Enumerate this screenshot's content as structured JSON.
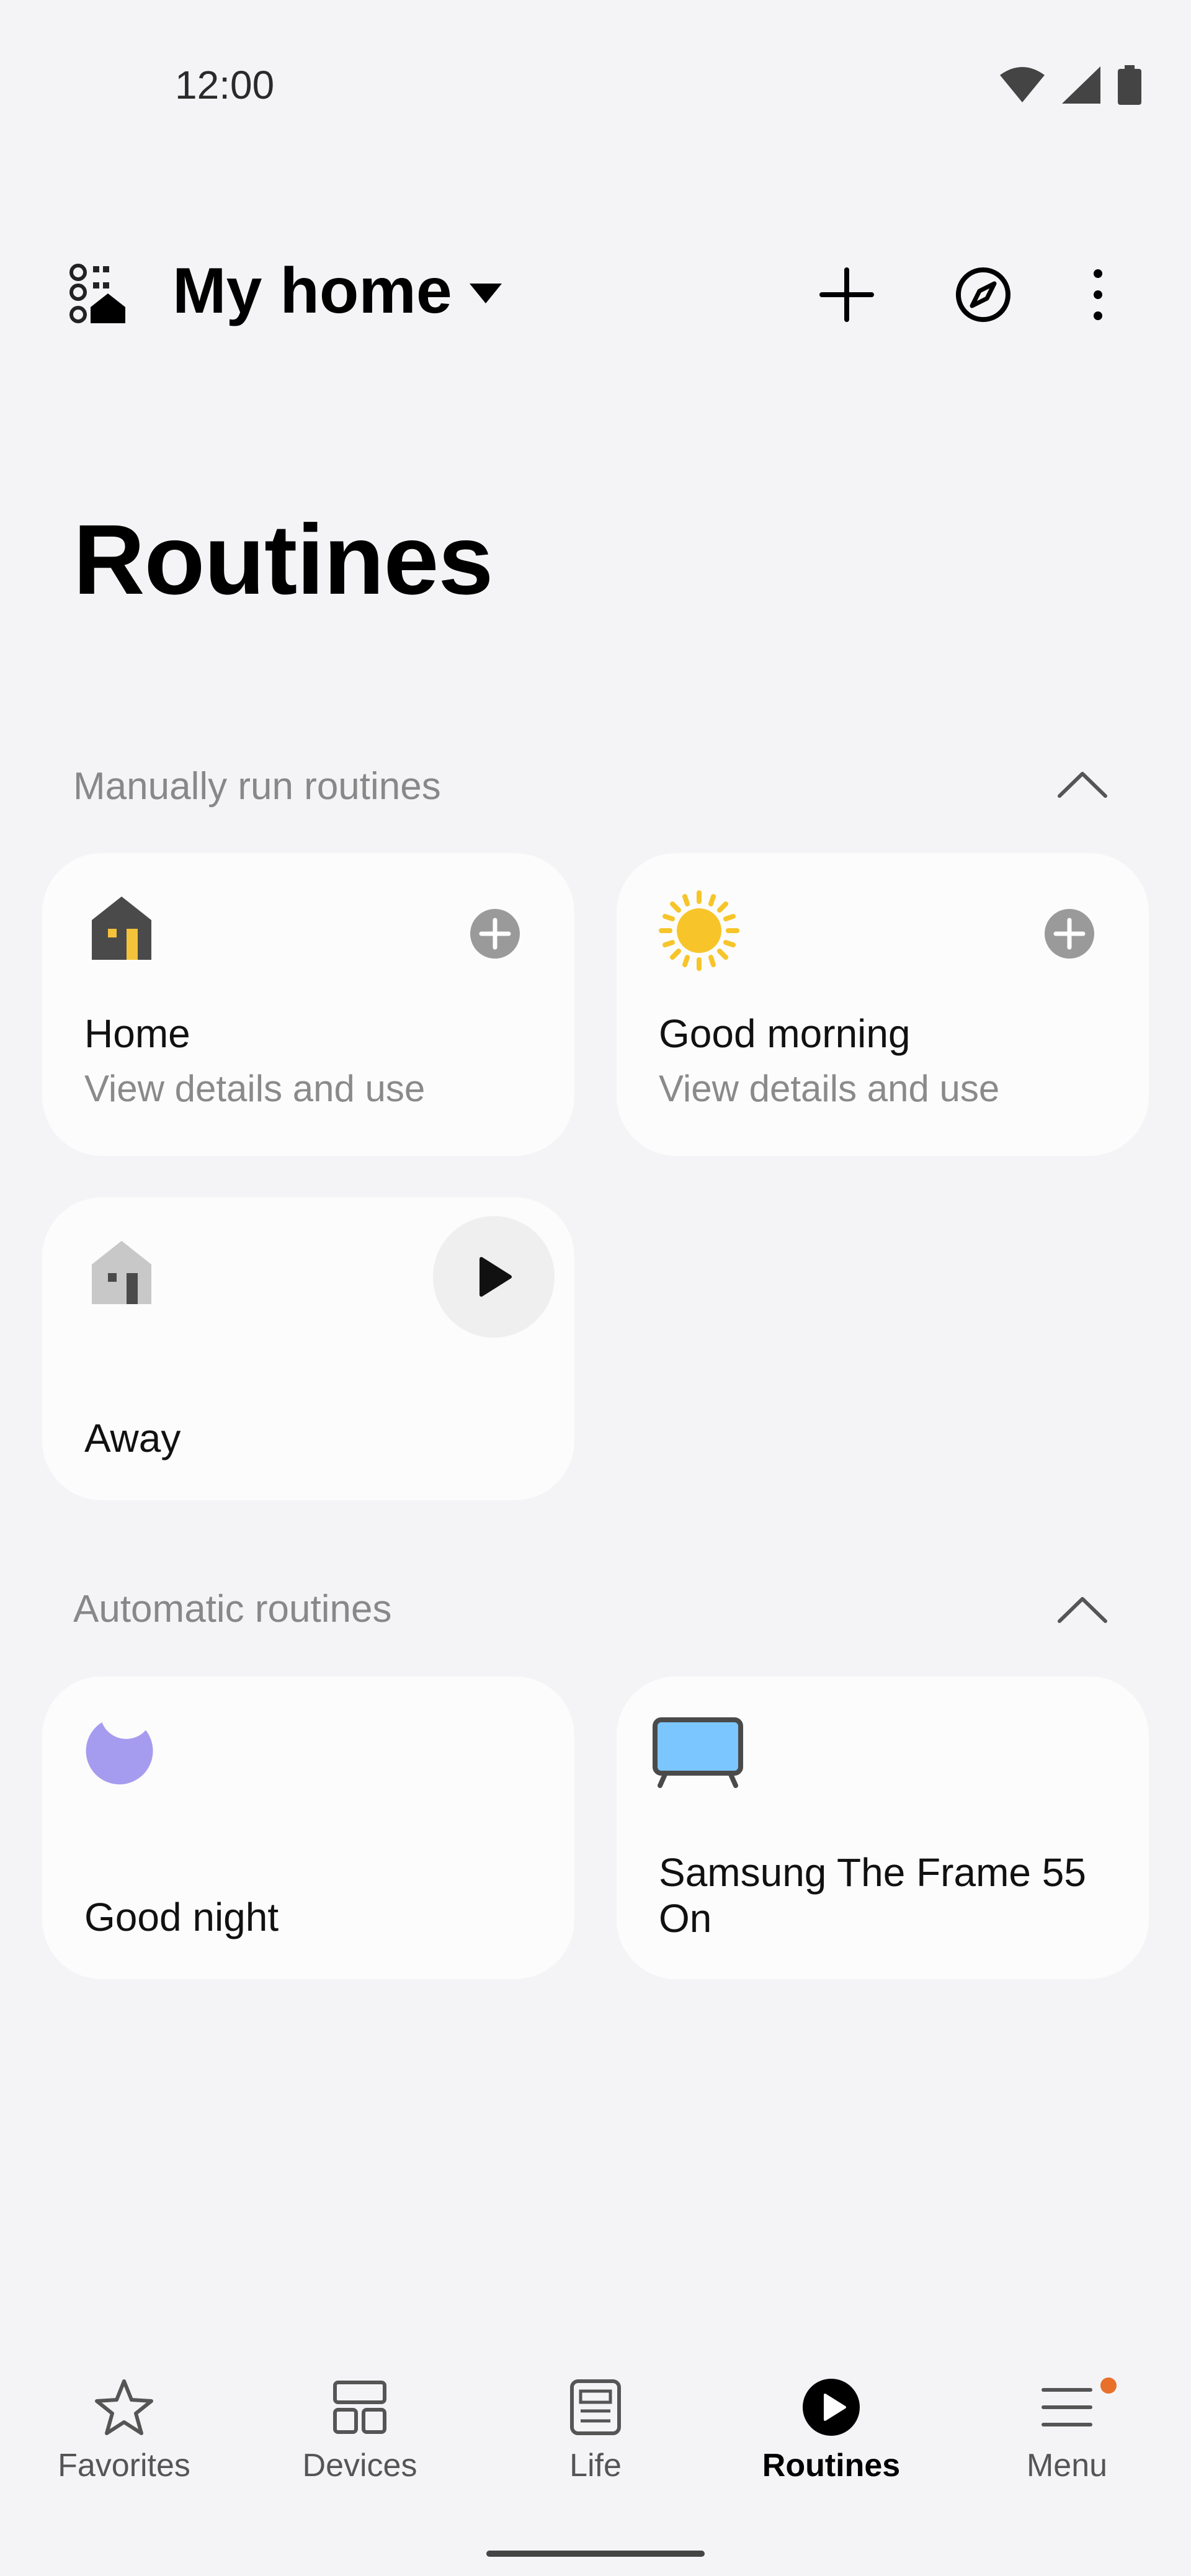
{
  "status_bar": {
    "time": "12:00"
  },
  "header": {
    "home_name": "My home"
  },
  "page": {
    "title": "Routines"
  },
  "sections": {
    "manual": {
      "label": "Manually run routines",
      "routines": [
        {
          "name": "Home",
          "subtitle": "View details and use",
          "icon": "house-icon-dark"
        },
        {
          "name": "Good morning",
          "subtitle": "View details and use",
          "icon": "sun-icon"
        },
        {
          "name": "Away",
          "subtitle": "",
          "icon": "house-icon-light"
        }
      ]
    },
    "automatic": {
      "label": "Automatic routines",
      "routines": [
        {
          "name": "Good night",
          "icon": "moon-icon"
        },
        {
          "name": "Samsung The Frame 55 On",
          "icon": "tv-icon"
        }
      ]
    }
  },
  "bottom_nav": {
    "items": [
      {
        "label": "Favorites",
        "icon": "star-icon"
      },
      {
        "label": "Devices",
        "icon": "devices-grid-icon"
      },
      {
        "label": "Life",
        "icon": "life-doc-icon"
      },
      {
        "label": "Routines",
        "icon": "play-circle-icon",
        "active": true
      },
      {
        "label": "Menu",
        "icon": "menu-icon",
        "badge": true
      }
    ]
  },
  "colors": {
    "background": "#f4f4f6",
    "card": "#fcfcfc",
    "sun": "#f7c52a",
    "moon": "#a59cf0",
    "tv_screen": "#7cc6ff",
    "badge": "#e8702a",
    "house_window": "#f5c33b"
  }
}
